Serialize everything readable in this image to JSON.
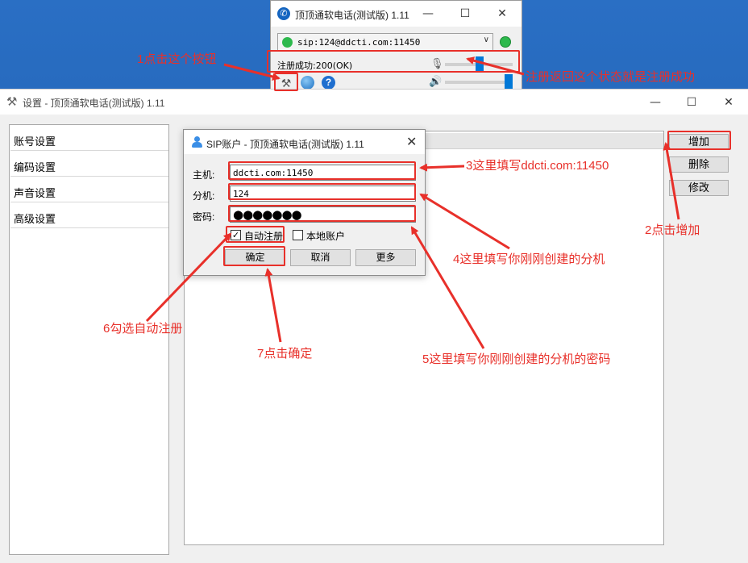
{
  "phone_window": {
    "title": "顶顶通软电话(测试版) 1.11",
    "sip_account": "sip:124@ddcti.com:11450",
    "status_text": "注册成功:200(OK)"
  },
  "settings_window": {
    "title": "设置 - 顶顶通软电话(测试版) 1.11",
    "nav_items": [
      "账号设置",
      "编码设置",
      "声音设置",
      "高级设置"
    ],
    "buttons": {
      "add": "增加",
      "delete": "删除",
      "edit": "修改"
    }
  },
  "sip_dialog": {
    "title": "SIP账户 - 顶顶通软电话(测试版) 1.11",
    "host_label": "主机:",
    "host_value": "ddcti.com:11450",
    "ext_label": "分机:",
    "ext_value": "124",
    "pwd_label": "密码:",
    "pwd_value": "●●●●●●●",
    "auto_register_label": "自动注册",
    "auto_register_checked": true,
    "local_account_label": "本地账户",
    "local_account_checked": false,
    "ok_button": "确定",
    "cancel_button": "取消",
    "more_button": "更多"
  },
  "annotations": {
    "step1": "1点击这个按钮",
    "status_note": "注册返回这个状态就是注册成功",
    "step2": "2点击增加",
    "step3": "3这里填写ddcti.com:11450",
    "step4": "4这里填写你刚刚创建的分机",
    "step5": "5这里填写你刚刚创建的分机的密码",
    "step6": "6勾选自动注册",
    "step7": "7点击确定"
  },
  "colors": {
    "annotation": "#e8302a",
    "accent": "#0078d7",
    "online": "#2db94d"
  }
}
